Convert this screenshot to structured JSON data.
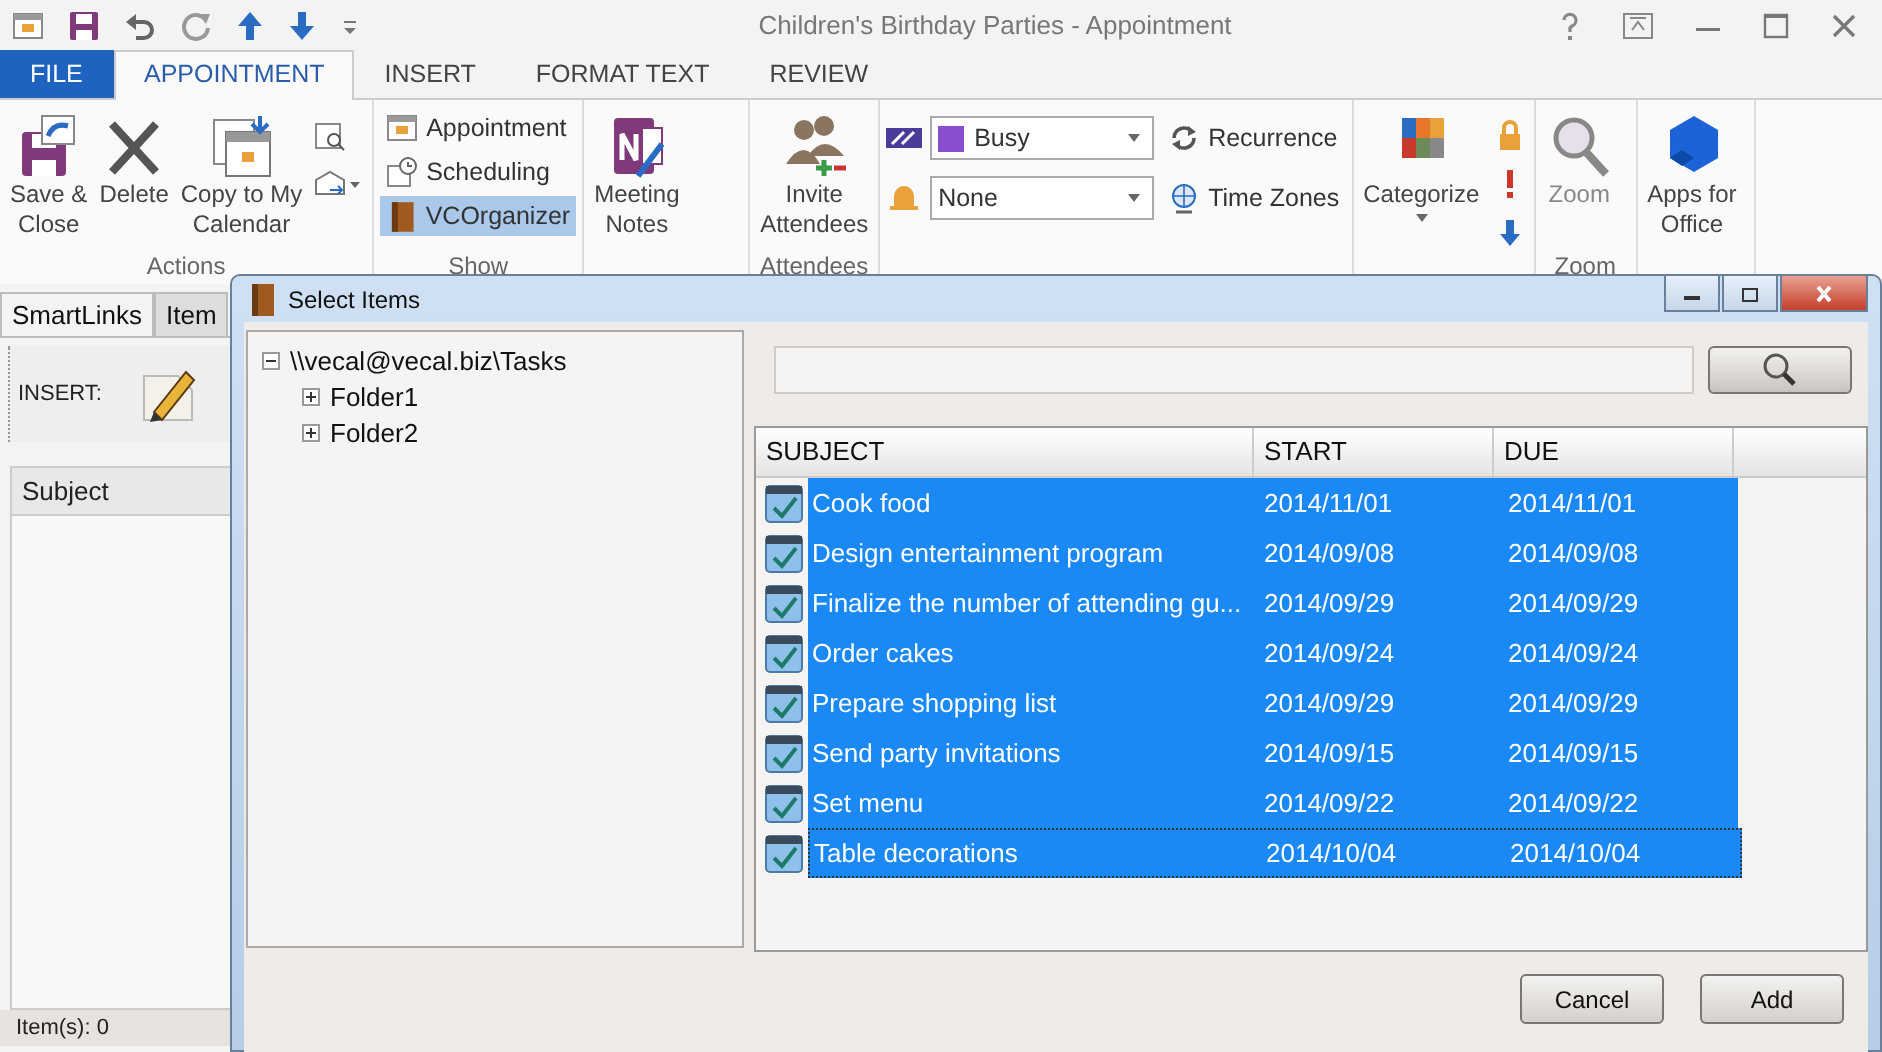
{
  "window": {
    "title": "Children's Birthday Parties - Appointment"
  },
  "ribbon_tabs": [
    {
      "label": "FILE",
      "kind": "file",
      "selected": false
    },
    {
      "label": "APPOINTMENT",
      "kind": "tab",
      "selected": true
    },
    {
      "label": "INSERT",
      "kind": "tab",
      "selected": false
    },
    {
      "label": "FORMAT TEXT",
      "kind": "tab",
      "selected": false
    },
    {
      "label": "REVIEW",
      "kind": "tab",
      "selected": false
    }
  ],
  "ribbon_groups": [
    {
      "label": "Actions",
      "items": [
        {
          "kind": "large",
          "label": "Save &\nClose"
        },
        {
          "kind": "large",
          "label": "Delete"
        },
        {
          "kind": "large",
          "label": "Copy to My\nCalendar"
        },
        {
          "kind": "icons"
        }
      ]
    },
    {
      "label": "Show",
      "items": [
        {
          "kind": "small",
          "label": "Appointment",
          "selected": false
        },
        {
          "kind": "small",
          "label": "Scheduling",
          "selected": false
        },
        {
          "kind": "small",
          "label": "VCOrganizer",
          "selected": true
        }
      ]
    },
    {
      "items": [
        {
          "kind": "large",
          "label": "Meeting\nNotes"
        }
      ]
    },
    {
      "label": "Attendees",
      "items": [
        {
          "kind": "large",
          "label": "Invite\nAttendees"
        }
      ]
    },
    {
      "items": [
        {
          "kind": "dropdown",
          "value": "Busy"
        },
        {
          "kind": "small",
          "label": "Recurrence",
          "selected": false
        },
        {
          "kind": "dropdown",
          "value": "None"
        },
        {
          "kind": "small",
          "label": "Time Zones",
          "selected": false
        }
      ]
    },
    {
      "items": [
        {
          "kind": "large",
          "label": "Categorize",
          "caret": true
        },
        {
          "kind": "icons"
        }
      ]
    },
    {
      "label": "Zoom",
      "items": [
        {
          "kind": "large",
          "label": "Zoom",
          "disabled": true
        }
      ]
    },
    {
      "items": [
        {
          "kind": "large",
          "label": "Apps for\nOffice"
        }
      ]
    }
  ],
  "side_pane": {
    "tabs": [
      {
        "label": "SmartLinks",
        "selected": true
      },
      {
        "label": "Item",
        "selected": false
      }
    ],
    "toolbar_label": "INSERT:",
    "column": "Subject",
    "status": "Item(s): 0"
  },
  "dialog": {
    "title": "Select Items",
    "tree": [
      {
        "label": "\\\\vecal@vecal.biz\\Tasks",
        "expanded": true,
        "children": [
          {
            "label": "Folder1",
            "expanded": false
          },
          {
            "label": "Folder2",
            "expanded": false
          }
        ]
      }
    ],
    "table": {
      "columns": [
        "SUBJECT",
        "START",
        "DUE"
      ],
      "rows": [
        {
          "subject": "Cook food",
          "start": "2014/11/01",
          "due": "2014/11/01",
          "selected": true,
          "focused": false
        },
        {
          "subject": "Design entertainment program",
          "start": "2014/09/08",
          "due": "2014/09/08",
          "selected": true,
          "focused": false
        },
        {
          "subject": "Finalize the number of attending gu...",
          "start": "2014/09/29",
          "due": "2014/09/29",
          "selected": true,
          "focused": false
        },
        {
          "subject": "Order cakes",
          "start": "2014/09/24",
          "due": "2014/09/24",
          "selected": true,
          "focused": false
        },
        {
          "subject": "Prepare shopping list",
          "start": "2014/09/29",
          "due": "2014/09/29",
          "selected": true,
          "focused": false
        },
        {
          "subject": "Send party invitations",
          "start": "2014/09/15",
          "due": "2014/09/15",
          "selected": true,
          "focused": false
        },
        {
          "subject": "Set menu",
          "start": "2014/09/22",
          "due": "2014/09/22",
          "selected": true,
          "focused": false
        },
        {
          "subject": "Table decorations",
          "start": "2014/10/04",
          "due": "2014/10/04",
          "selected": true,
          "focused": true
        }
      ]
    },
    "buttons": [
      "Cancel",
      "Add"
    ]
  }
}
